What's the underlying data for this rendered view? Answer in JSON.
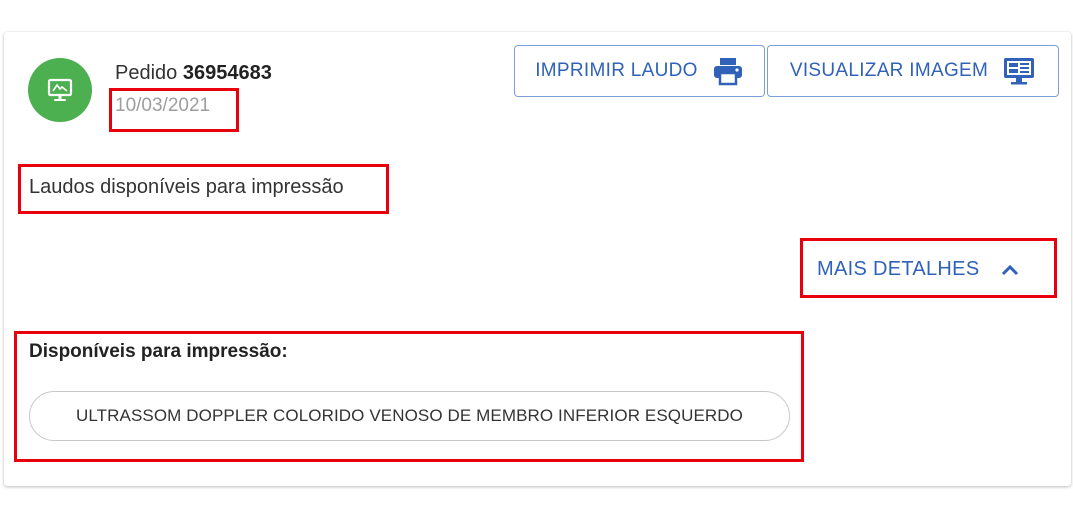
{
  "order": {
    "label": "Pedido",
    "number": "36954683",
    "date": "10/03/2021"
  },
  "avatar": {
    "icon": "monitor-exam-icon",
    "color": "#4caf50"
  },
  "actions": {
    "print_label": "IMPRIMIR LAUDO",
    "print_icon": "printer-icon",
    "view_label": "VISUALIZAR IMAGEM",
    "view_icon": "monitor-icon"
  },
  "status_text": "Laudos disponíveis para impressão",
  "details": {
    "toggle_label": "MAIS DETALHES",
    "toggle_icon": "chevron-up-icon",
    "available_title": "Disponíveis para impressão:",
    "exams": [
      "ULTRASSOM DOPPLER COLORIDO VENOSO DE MEMBRO INFERIOR ESQUERDO"
    ]
  },
  "colors": {
    "accent": "#2f62b8",
    "highlight": "#e8000d",
    "date": "#9e9e9e"
  }
}
